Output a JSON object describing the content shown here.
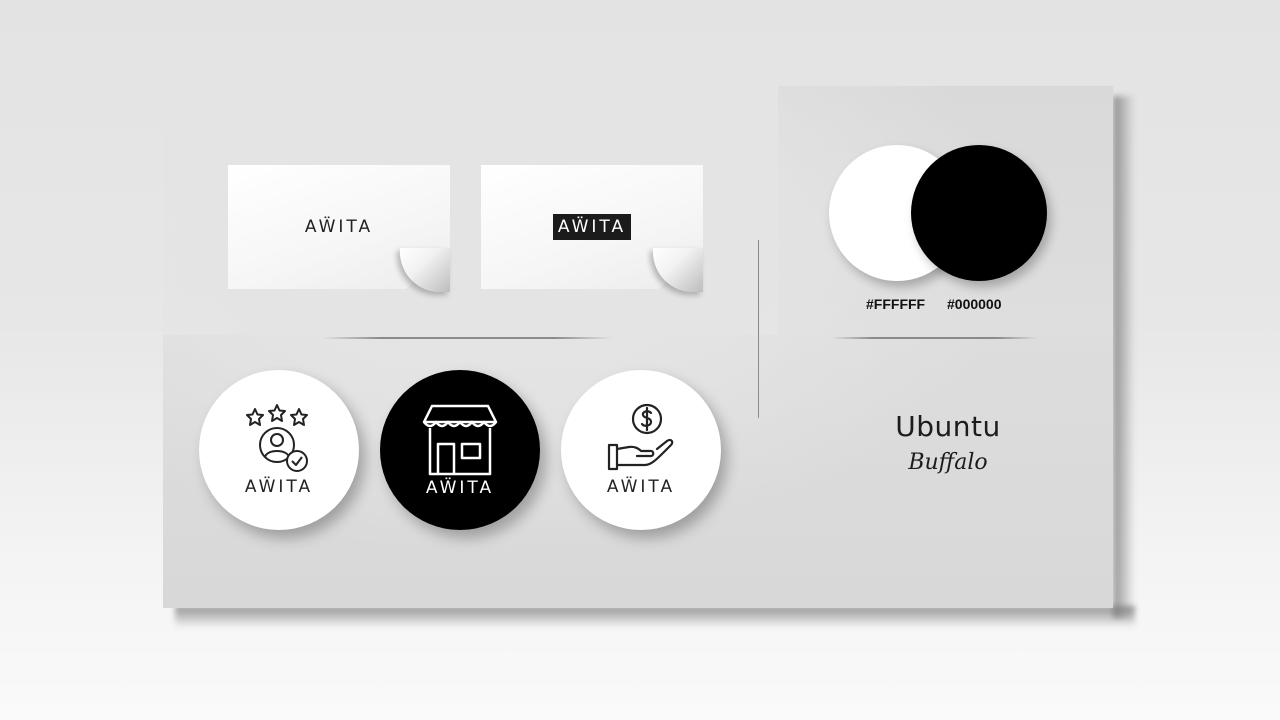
{
  "brand": {
    "logo_text": "AẄITA"
  },
  "business_cards": [
    {
      "logo": "AẄITA",
      "style": "light"
    },
    {
      "logo": "AẄITA",
      "style": "dark-block"
    }
  ],
  "color_palette": {
    "swatches": [
      {
        "label": "#FFFFFF",
        "color": "#FFFFFF"
      },
      {
        "label": "#000000",
        "color": "#000000"
      }
    ]
  },
  "stickers": [
    {
      "icon": "rating-user-icon",
      "label": "AẄITA",
      "background": "#FFFFFF"
    },
    {
      "icon": "storefront-icon",
      "label": "AẄITA",
      "background": "#000000"
    },
    {
      "icon": "money-hand-icon",
      "label": "AẄITA",
      "background": "#FFFFFF"
    }
  ],
  "typography": {
    "primary_font": "Ubuntu",
    "secondary_font": "Buffalo"
  }
}
